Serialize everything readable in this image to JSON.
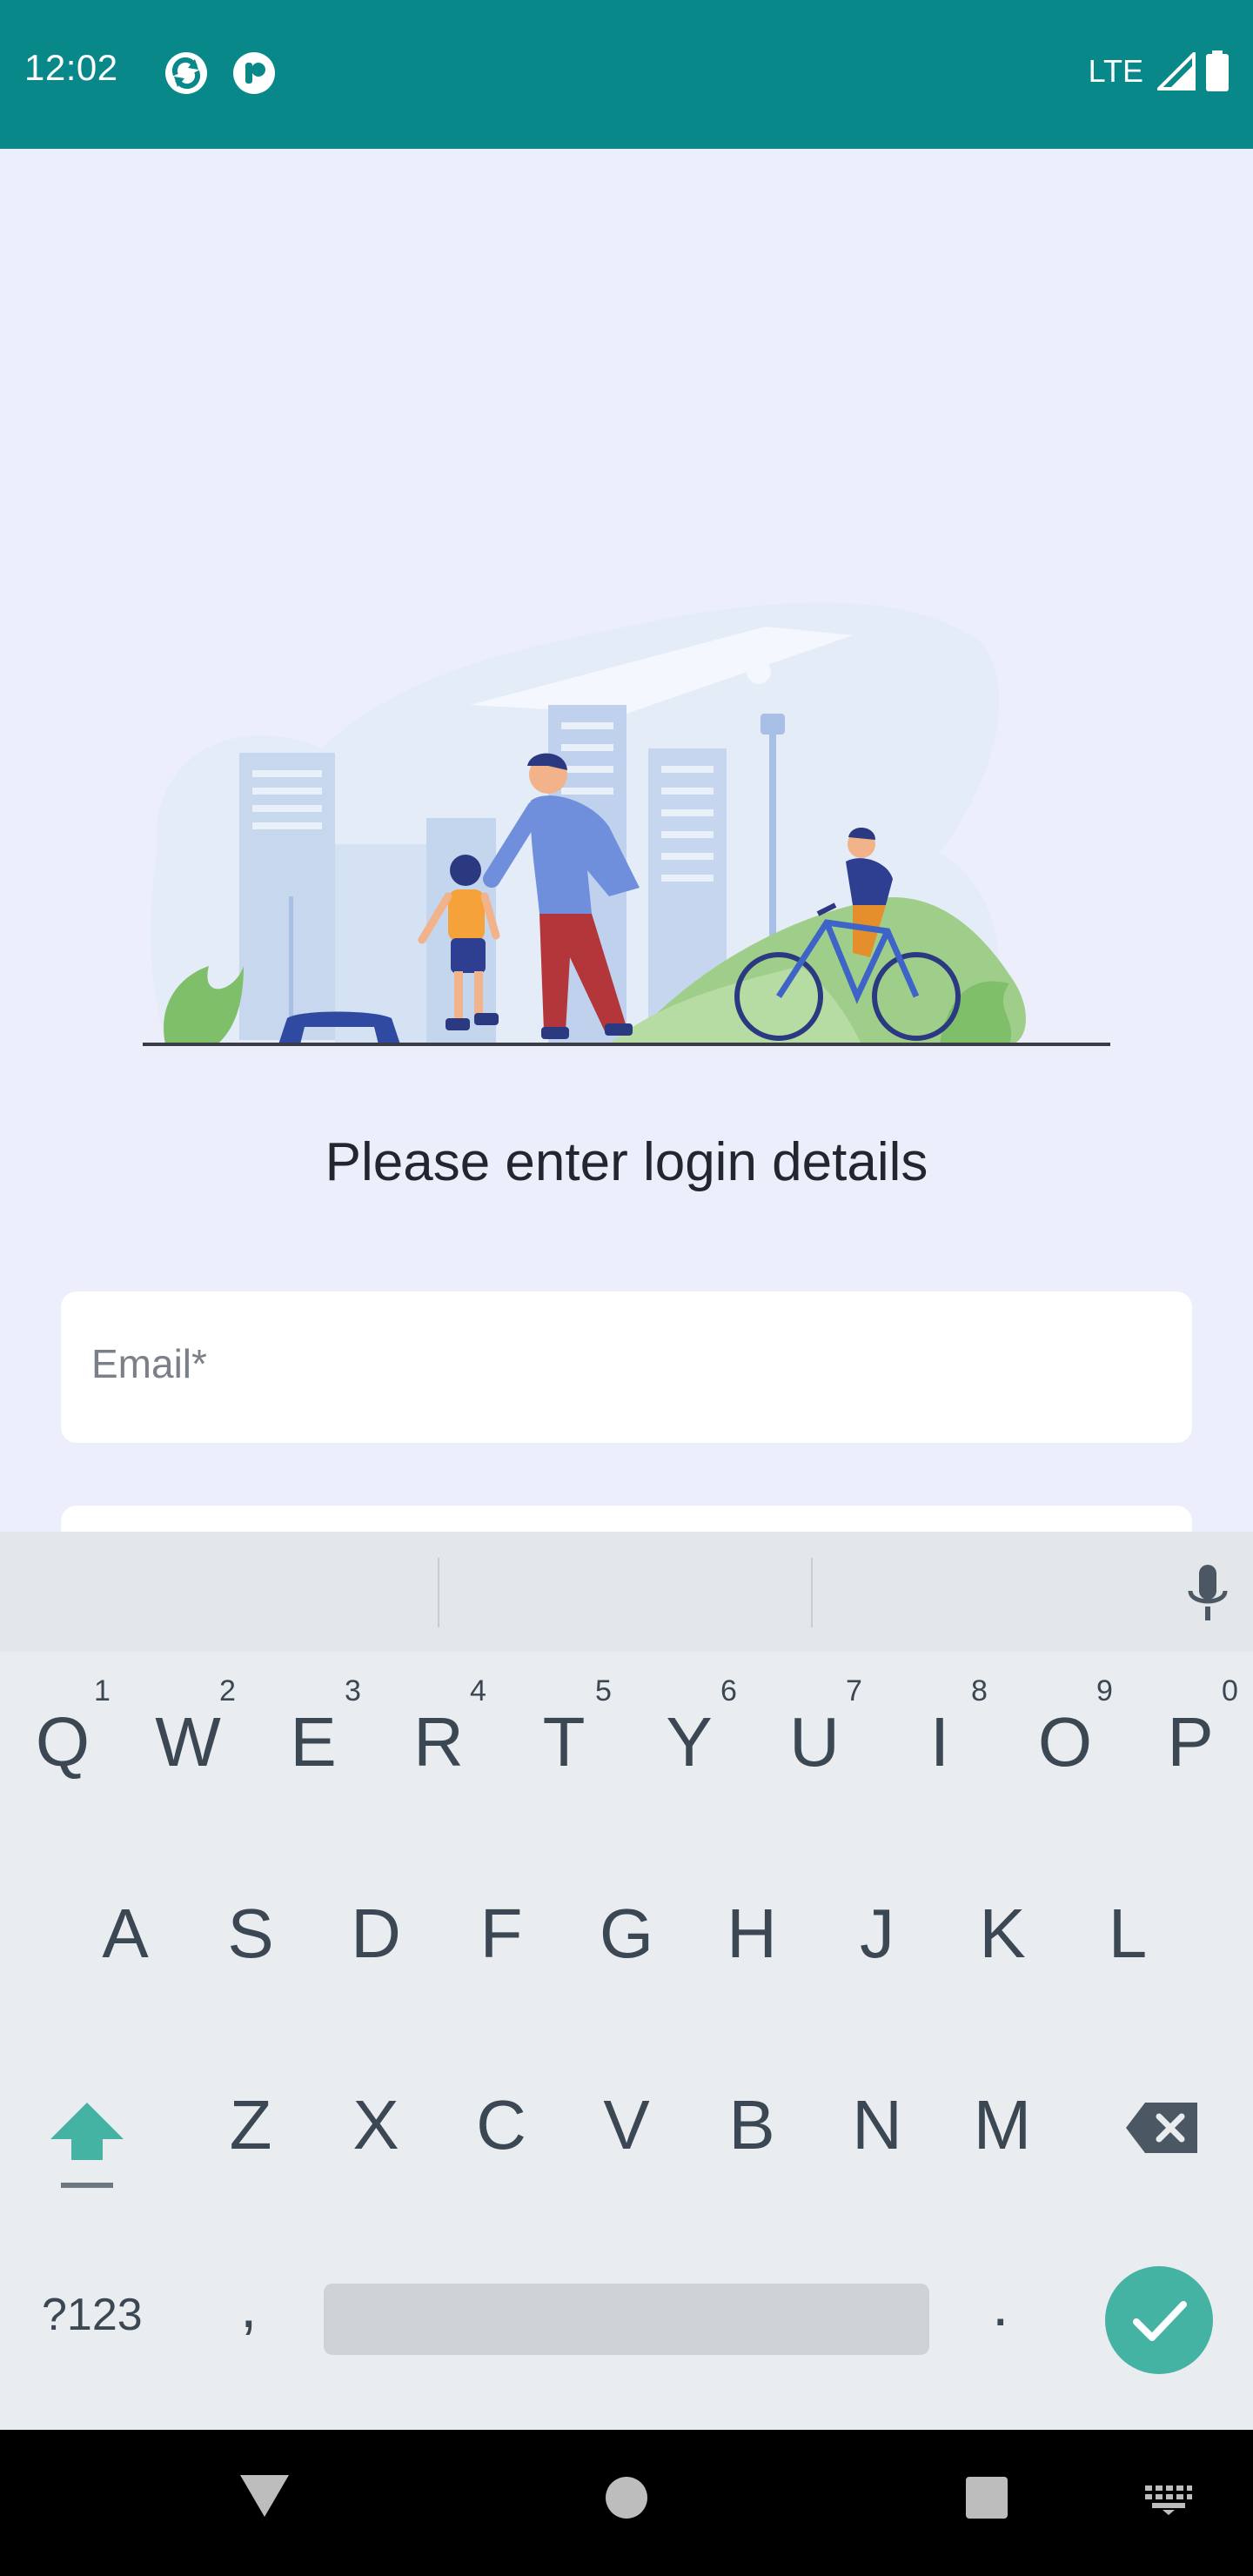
{
  "status_bar": {
    "time": "12:02",
    "network": "LTE",
    "icons": [
      "sync-app-icon",
      "app-notification-icon",
      "signal-icon",
      "battery-icon"
    ],
    "background_color": "#09888a"
  },
  "login": {
    "title": "Please enter login details",
    "email_placeholder": "Email*"
  },
  "keyboard": {
    "row1": [
      {
        "key": "Q",
        "hint": "1"
      },
      {
        "key": "W",
        "hint": "2"
      },
      {
        "key": "E",
        "hint": "3"
      },
      {
        "key": "R",
        "hint": "4"
      },
      {
        "key": "T",
        "hint": "5"
      },
      {
        "key": "Y",
        "hint": "6"
      },
      {
        "key": "U",
        "hint": "7"
      },
      {
        "key": "I",
        "hint": "8"
      },
      {
        "key": "O",
        "hint": "9"
      },
      {
        "key": "P",
        "hint": "0"
      }
    ],
    "row2": [
      "A",
      "S",
      "D",
      "F",
      "G",
      "H",
      "J",
      "K",
      "L"
    ],
    "row3": [
      "Z",
      "X",
      "C",
      "V",
      "B",
      "N",
      "M"
    ],
    "symbols_label": "?123",
    "comma": ",",
    "period": ".",
    "accent_color": "#45b3a3"
  },
  "nav_bar": {
    "icons": [
      "back-icon",
      "home-icon",
      "recents-icon",
      "keyboard-switch-icon"
    ]
  }
}
